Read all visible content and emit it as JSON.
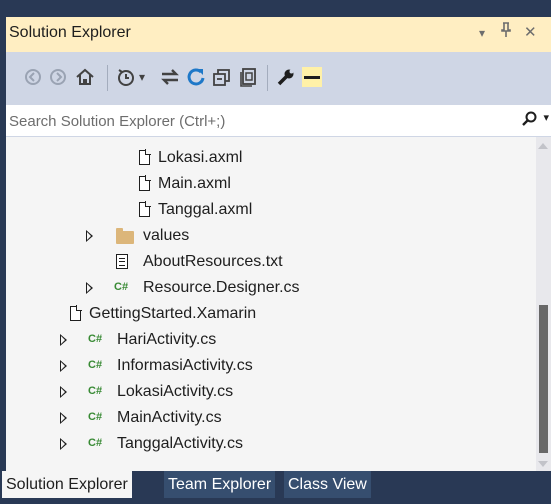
{
  "window": {
    "title": "Solution Explorer",
    "dropdown_glyph": "▾",
    "pin_glyph": "📌",
    "close_glyph": "✕"
  },
  "toolbar": {
    "buttons": [
      {
        "name": "back",
        "glyph": "◯"
      },
      {
        "name": "forward",
        "glyph": "◯"
      },
      {
        "name": "home",
        "glyph": "⌂"
      },
      {
        "name": "pending-changes",
        "glyph": "◷"
      },
      {
        "name": "dropdown",
        "glyph": "▾"
      },
      {
        "name": "sync",
        "glyph": "⇆"
      },
      {
        "name": "refresh",
        "glyph": "↻"
      },
      {
        "name": "collapse-all",
        "glyph": "⧉"
      },
      {
        "name": "show-all-files",
        "glyph": "⎘"
      },
      {
        "name": "properties",
        "glyph": "🔧"
      },
      {
        "name": "preview",
        "glyph": "▬"
      }
    ]
  },
  "search": {
    "placeholder": "Search Solution Explorer (Ctrl+;)",
    "value": "",
    "icon": "search-icon",
    "dropdown_glyph": "▾"
  },
  "tree": {
    "items": [
      {
        "label": "Lokasi.axml",
        "type": "file",
        "expander": false
      },
      {
        "label": "Main.axml",
        "type": "file",
        "expander": false
      },
      {
        "label": "Tanggal.axml",
        "type": "file",
        "expander": false
      },
      {
        "label": "values",
        "type": "folder",
        "expander": true
      },
      {
        "label": "AboutResources.txt",
        "type": "text",
        "expander": false
      },
      {
        "label": "Resource.Designer.cs",
        "type": "csharp",
        "expander": true
      },
      {
        "label": "GettingStarted.Xamarin",
        "type": "file",
        "expander": false
      },
      {
        "label": "HariActivity.cs",
        "type": "csharp",
        "expander": true
      },
      {
        "label": "InformasiActivity.cs",
        "type": "csharp",
        "expander": true
      },
      {
        "label": "LokasiActivity.cs",
        "type": "csharp",
        "expander": true
      },
      {
        "label": "MainActivity.cs",
        "type": "csharp",
        "expander": true
      },
      {
        "label": "TanggalActivity.cs",
        "type": "csharp",
        "expander": true
      }
    ],
    "csharp_badge": "C#"
  },
  "tabs": [
    {
      "label": "Solution Explorer",
      "active": true
    },
    {
      "label": "Team Explorer",
      "active": false
    },
    {
      "label": "Class View",
      "active": false
    }
  ],
  "colors": {
    "frame": "#293955",
    "title_bar": "#ffeec2",
    "toolbar": "#cfd6e5",
    "panel_bg": "#f5f5f5",
    "csharp_icon": "#388a34",
    "folder_icon": "#dcb67a",
    "inactive_tab": "#364e6f"
  }
}
